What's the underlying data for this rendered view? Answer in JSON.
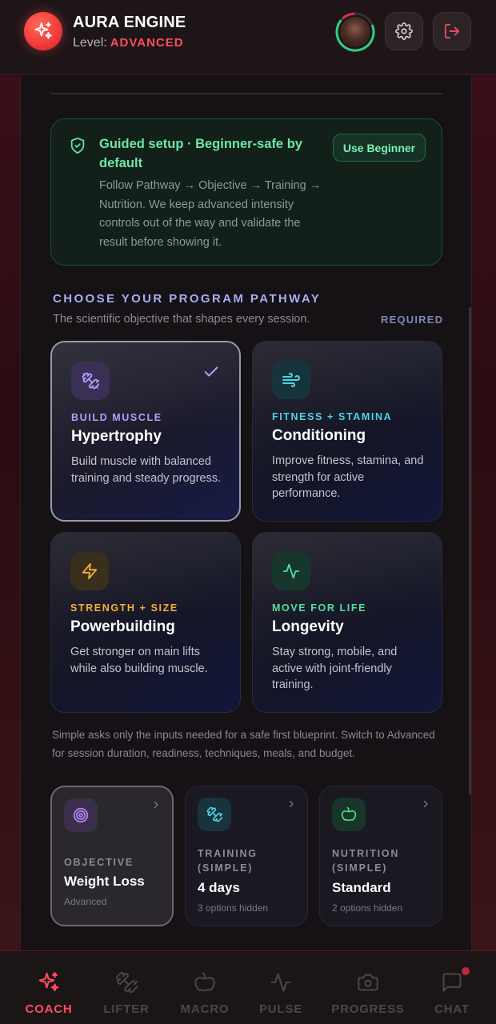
{
  "header": {
    "app_title": "AURA ENGINE",
    "level_label": "Level:",
    "level_value": "ADVANCED",
    "avatar_icon": "avatar",
    "settings_icon": "gear-icon",
    "logout_icon": "logout-icon"
  },
  "guided": {
    "title": "Guided setup · Beginner-safe by default",
    "body": "Follow Pathway → Objective → Training → Nutrition. We keep advanced intensity controls out of the way and validate the result before showing it.",
    "button": "Use Beginner",
    "icon": "shield-check-icon"
  },
  "pathway": {
    "title": "CHOOSE YOUR PROGRAM PATHWAY",
    "subtitle": "The scientific objective that shapes every session.",
    "required": "REQUIRED",
    "cards": [
      {
        "eyebrow": "BUILD MUSCLE",
        "title": "Hypertrophy",
        "desc": "Build muscle with balanced training and steady progress.",
        "icon": "dumbbell-icon",
        "accent": "#b79cff",
        "selected": true
      },
      {
        "eyebrow": "FITNESS + STAMINA",
        "title": "Conditioning",
        "desc": "Improve fitness, stamina, and strength for active performance.",
        "icon": "wind-icon",
        "accent": "#4fd1e6",
        "selected": false
      },
      {
        "eyebrow": "STRENGTH + SIZE",
        "title": "Powerbuilding",
        "desc": "Get stronger on main lifts while also building muscle.",
        "icon": "lightning-icon",
        "accent": "#f2b035",
        "selected": false
      },
      {
        "eyebrow": "MOVE FOR LIFE",
        "title": "Longevity",
        "desc": "Stay strong, mobile, and active with joint-friendly training.",
        "icon": "pulse-icon",
        "accent": "#4fe0a0",
        "selected": false
      }
    ]
  },
  "simple_note": "Simple asks only the inputs needed for a safe first blueprint. Switch to Advanced for session duration, readiness, techniques, meals, and budget.",
  "summary": [
    {
      "label": "OBJECTIVE",
      "value": "Weight Loss",
      "sub": "Advanced",
      "icon": "target-icon",
      "accent": "#b084f5"
    },
    {
      "label": "TRAINING (SIMPLE)",
      "value": "4 days",
      "sub": "3 options hidden",
      "icon": "dumbbell-icon",
      "accent": "#4fd1e6"
    },
    {
      "label": "NUTRITION (SIMPLE)",
      "value": "Standard",
      "sub": "2 options hidden",
      "icon": "apple-icon",
      "accent": "#4fe07a"
    }
  ],
  "nav": [
    {
      "label": "COACH",
      "icon": "sparkle-icon",
      "active": true
    },
    {
      "label": "LIFTER",
      "icon": "dumbbell-icon",
      "active": false
    },
    {
      "label": "MACRO",
      "icon": "apple-icon",
      "active": false
    },
    {
      "label": "PULSE",
      "icon": "pulse-icon",
      "active": false
    },
    {
      "label": "PROGRESS",
      "icon": "camera-icon",
      "active": false
    },
    {
      "label": "CHAT",
      "icon": "chat-icon",
      "active": false
    }
  ],
  "colors": {
    "accent_red": "#ff4d5e",
    "green": "#6ee7a8",
    "section_title": "#a6aef0"
  }
}
